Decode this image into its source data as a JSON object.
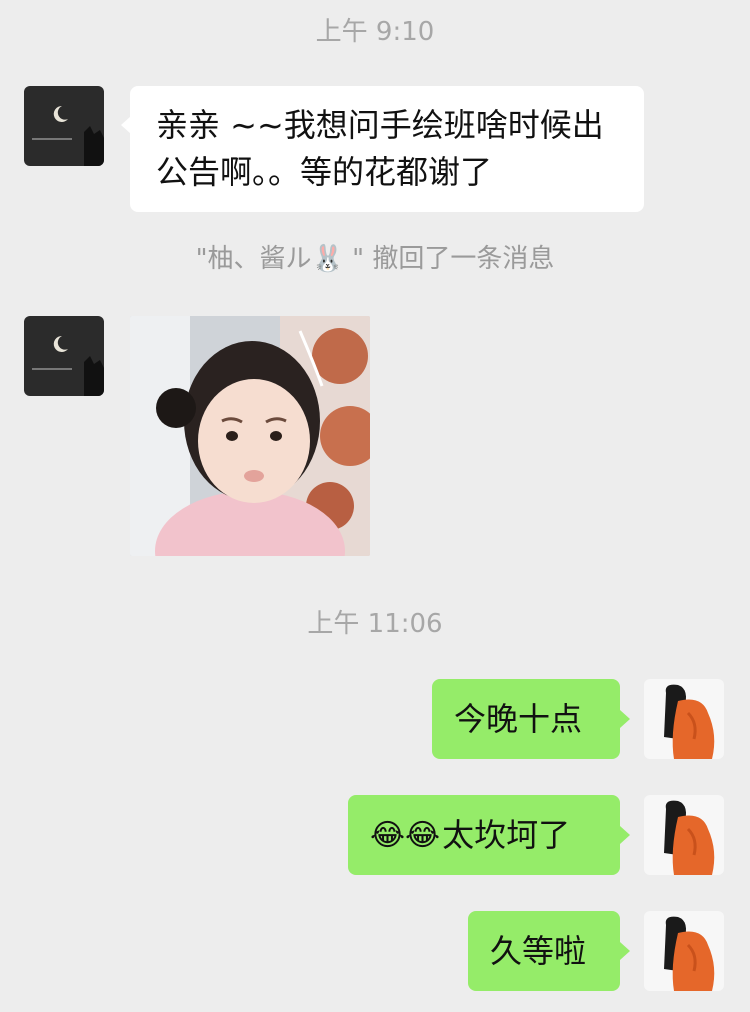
{
  "chat": {
    "timestamps": [
      "上午 9:10",
      "上午 11:06"
    ],
    "recall_notice": "\"柚、酱ル🐰 \" 撤回了一条消息",
    "messages": {
      "left1": "亲亲 ~~我想问手绘班啥时候出公告啊。。等的花都谢了",
      "right1": "今晚十点",
      "right2_emoji": "😂😂",
      "right2_text": "太坎坷了",
      "right3": "久等啦"
    }
  },
  "avatars": {
    "left_icon": "moon-night-avatar-icon",
    "right_icon": "orange-hoodie-avatar-icon"
  },
  "sticker": {
    "icon": "pouting-child-sticker"
  },
  "colors": {
    "background": "#ededed",
    "incoming_bubble": "#ffffff",
    "outgoing_bubble": "#95ec69"
  }
}
